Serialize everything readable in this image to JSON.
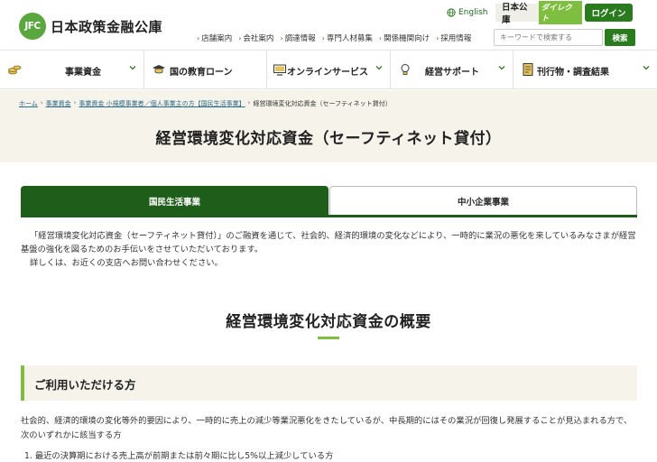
{
  "header": {
    "logo_mark": "JFC",
    "logo_text": "日本政策金融公庫",
    "english_label": "English",
    "direct_label": "日本公庫",
    "direct_tag": "ダイレクト",
    "login_label": "ログイン",
    "util_links": [
      "店舗案内",
      "会社案内",
      "調達情報",
      "専門人材募集",
      "関係機関向け",
      "採用情報"
    ],
    "search_placeholder": "キーワードで検索する",
    "search_button": "検索"
  },
  "gnav": {
    "items": [
      "事業資金",
      "国の教育ローン",
      "オンラインサービス",
      "経営サポート",
      "刊行物・調査結果"
    ]
  },
  "breadcrumb": {
    "items": [
      "ホーム",
      "事業資金",
      "事業資金 小規模事業者／個人事業主の方【国民生活事業】",
      "経営環境変化対応資金（セーフティネット貸付）"
    ]
  },
  "page_title": "経営環境変化対応資金（セーフティネット貸付）",
  "tabs": {
    "active": "国民生活事業",
    "inactive": "中小企業事業"
  },
  "intro": {
    "line1": "「経営環境変化対応資金（セーフティネット貸付）」のご融資を通じて、社会的、経済的環境の変化などにより、一時的に業況の悪化を来しているみなさまが経営基盤の強化を図るためのお手伝いをさせていただいております。",
    "line2": "詳しくは、お近くの支店へお問い合わせください。"
  },
  "section_title": "経営環境変化対応資金の概要",
  "sub_heading": "ご利用いただける方",
  "body_text": "社会的、経済的環境の変化等外的要因により、一時的に売上の減少等業況悪化をきたしているが、中長期的にはその業況が回復し発展することが見込まれる方で、次のいずれかに該当する方",
  "list_item_1": "1. 最近の決算期における売上高が前期または前々期に比し5%以上減少している方",
  "colors": {
    "brand_green": "#2a7a1e",
    "accent_green": "#7fbf3f",
    "band": "#f6f3ea"
  }
}
